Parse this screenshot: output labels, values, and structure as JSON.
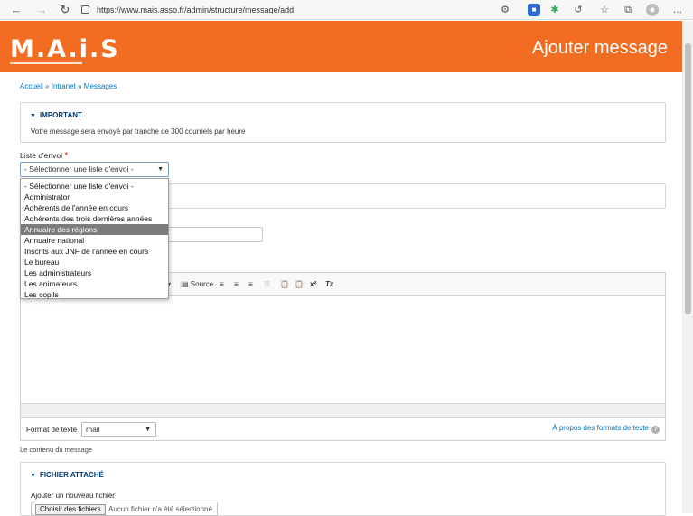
{
  "browser": {
    "url": "https://www.mais.asso.fr/admin/structure/message/add"
  },
  "header": {
    "logo": "M.A.i.S",
    "title": "Ajouter message"
  },
  "breadcrumb": {
    "items": [
      "Accueil",
      "Intranet",
      "Messages"
    ],
    "separator": "»"
  },
  "important": {
    "summary": "IMPORTANT",
    "text": "Votre message sera envoyé par tranche de 300 courriels par heure"
  },
  "liste_envoi": {
    "label": "Liste d'envoi",
    "required_mark": "*",
    "value": "- Sélectionner une liste d'envoi -",
    "options": [
      "- Sélectionner une liste d'envoi -",
      "Administrator",
      "Adhérents de l'année en cours",
      "Adhérents des trois dernières années",
      "Annuaire des régions",
      "Annuaire national",
      "Inscrits aux JNF de l'année en cours",
      "Le bureau",
      "Les administrateurs",
      "Les animateurs",
      "Les copils"
    ],
    "highlighted_index": 4
  },
  "editor": {
    "toolbar": {
      "source_label": "Source",
      "superscript_label": "x²",
      "remove_format_label": "Tx"
    },
    "format_label": "Format de texte",
    "format_value": "mail",
    "format_link": "À propos des formats de texte",
    "help_glyph": "?",
    "description": "Le contenu du message"
  },
  "fichier": {
    "summary": "FICHIER ATTACHÉ",
    "label": "Ajouter un nouveau fichier",
    "button": "Choisir des fichiers",
    "status": "Aucun fichier n'a été sélectionné"
  },
  "colors": {
    "brand_orange": "#f26d21",
    "link_blue": "#0071b8",
    "summary_blue": "#003b75",
    "highlight_gray": "#7c7c7c"
  }
}
